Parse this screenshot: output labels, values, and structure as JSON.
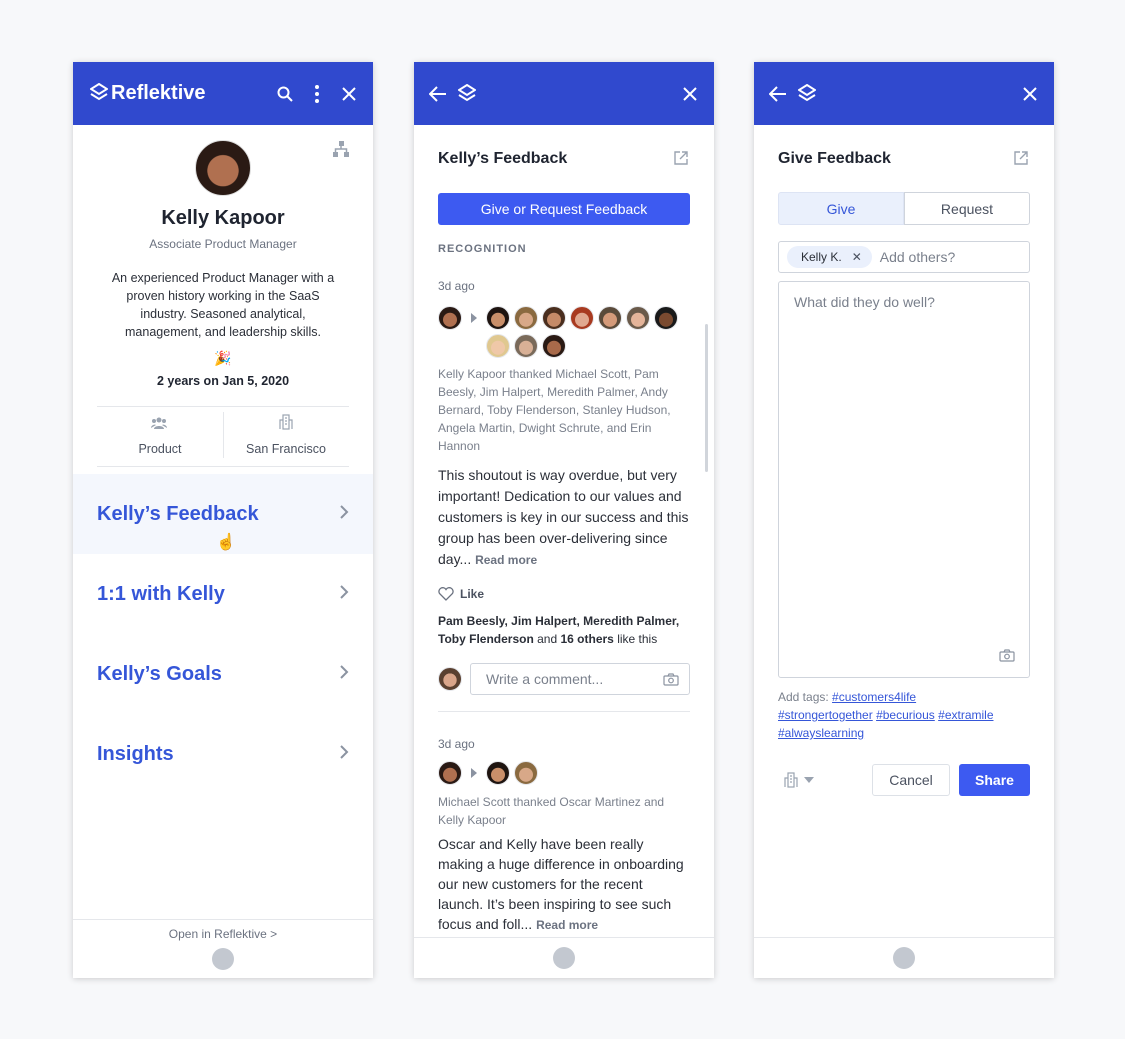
{
  "colors": {
    "header": "#3049ce",
    "accent": "#3d5af1",
    "nav_text": "#3556d8"
  },
  "profile": {
    "brand": "Reflektive",
    "icons": [
      "reflektive-logo-icon",
      "search-icon",
      "more-vertical-icon",
      "close-icon",
      "org-chart-icon"
    ],
    "name": "Kelly Kapoor",
    "title": "Associate Product Manager",
    "bio": "An experienced Product Manager with a proven history working in the SaaS industry. Seasoned analytical, management, and leadership skills.",
    "emoji": "🎉",
    "tenure": "2 years on Jan 5, 2020",
    "department": "Product",
    "location": "San Francisco",
    "nav": [
      {
        "label": "Kelly’s Feedback",
        "active": true
      },
      {
        "label": "1:1 with Kelly"
      },
      {
        "label": "Kelly’s Goals"
      },
      {
        "label": "Insights"
      }
    ],
    "footer_link": "Open in Reflektive >"
  },
  "feedback": {
    "title": "Kelly’s Feedback",
    "button": "Give or Request Feedback",
    "section": "RECOGNITION",
    "posts": [
      {
        "time": "3d ago",
        "thanks": "Kelly Kapoor thanked Michael Scott, Pam Beesly, Jim Halpert, Meredith Palmer, Andy Bernard, Toby Flenderson, Stanley Hudson, Angela Martin, Dwight Schrute, and Erin Hannon",
        "message": "This shoutout is way overdue, but very important! Dedication to our values and customers is key in our success and this group has been over-delivering since day...",
        "read_more": "Read more",
        "like": "Like",
        "likers": "Pam Beesly, Jim Halpert, Meredith Palmer, Toby Flenderson",
        "and": " and ",
        "others": "16 others",
        "like_suffix": " like this",
        "comment_placeholder": "Write a comment..."
      },
      {
        "time": "3d ago",
        "thanks": "Michael Scott thanked Oscar Martinez and Kelly Kapoor",
        "message": "Oscar and Kelly have been really making a huge difference in onboarding our new customers for the recent launch. It’s been inspiring to see such focus and foll...",
        "read_more": "Read more"
      }
    ]
  },
  "give": {
    "title": "Give Feedback",
    "tabs": [
      {
        "label": "Give",
        "active": true
      },
      {
        "label": "Request"
      }
    ],
    "recipient_chip": "Kelly K.",
    "recipient_placeholder": "Add others?",
    "message_placeholder": "What did they do well?",
    "tags_label": "Add tags:",
    "tags": [
      "#customers4life",
      "#strongertogether",
      "#becurious",
      "#extramile",
      "#alwayslearning"
    ],
    "cancel": "Cancel",
    "share": "Share"
  }
}
